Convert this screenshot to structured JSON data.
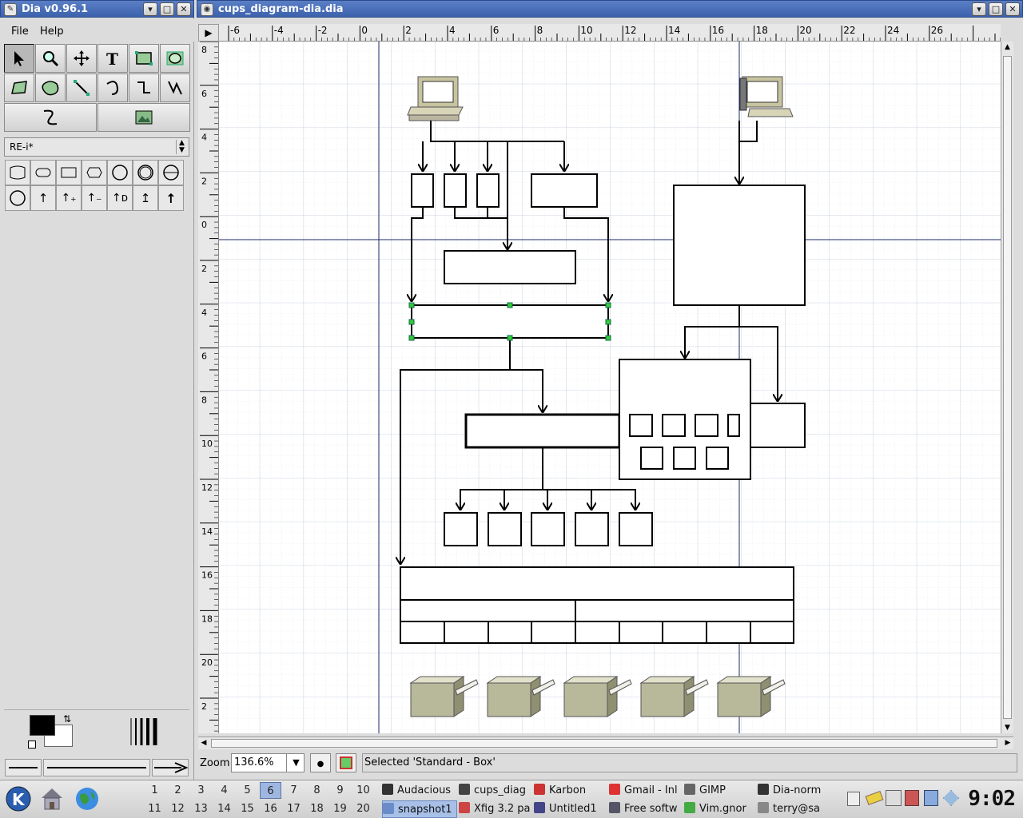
{
  "toolbox": {
    "title": "Dia v0.96.1",
    "menu": {
      "file": "File",
      "help": "Help"
    },
    "sheet_selected": "RE-i*"
  },
  "diagram": {
    "title": "cups_diagram-dia.dia",
    "hruler_labels": [
      "-6",
      "-4",
      "-2",
      "0",
      "2",
      "4",
      "6",
      "8",
      "10",
      "12",
      "14",
      "16",
      "18",
      "20",
      "22",
      "24",
      "26"
    ],
    "vruler_labels": [
      "8",
      "6",
      "4",
      "2",
      "0",
      "2",
      "4",
      "6",
      "8",
      "10",
      "12",
      "14",
      "16",
      "18",
      "20",
      "2"
    ],
    "zoom_label": "Zoom",
    "zoom_value": "136.6%",
    "status_text": "Selected 'Standard - Box'"
  },
  "taskbar": {
    "pager_row1": [
      "1",
      "2",
      "3",
      "4",
      "5",
      "6",
      "7",
      "8",
      "9",
      "10"
    ],
    "pager_row2": [
      "11",
      "12",
      "13",
      "14",
      "15",
      "16",
      "17",
      "18",
      "19",
      "20"
    ],
    "tasks_row1": [
      "Audacious",
      "cups_diag",
      "Karbon",
      "Gmail - Inl",
      "GIMP",
      "Dia-norm"
    ],
    "tasks_row2": [
      "snapshot1",
      "Xfig 3.2 pa",
      "Untitled1",
      "Free softw",
      "Vim.gnor",
      "terry@sa"
    ],
    "clock": "9:02",
    "colors": {
      "active_task": "#a8c0e8",
      "titlebar": "#4a6fb8"
    }
  }
}
